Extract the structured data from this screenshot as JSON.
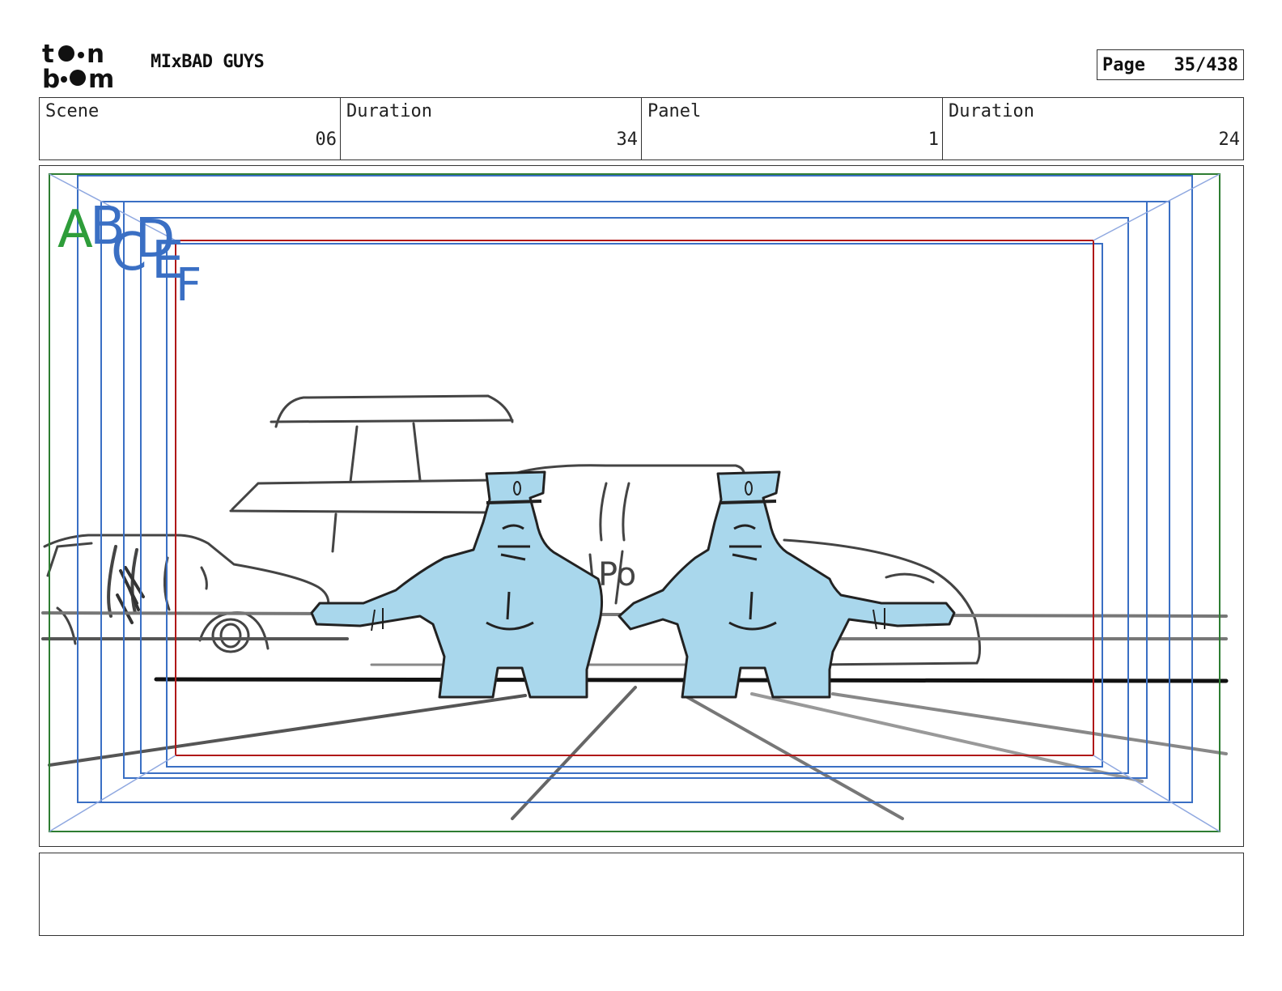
{
  "header": {
    "logo_lines": [
      "toon",
      "boom"
    ],
    "project_title": "MIxBAD GUYS",
    "page_label": "Page",
    "page_number": "35/438"
  },
  "info": {
    "scene_label": "Scene",
    "scene_value": "06",
    "scene_duration_label": "Duration",
    "scene_duration_value": "34",
    "panel_label": "Panel",
    "panel_value": "1",
    "panel_duration_label": "Duration",
    "panel_duration_value": "24"
  },
  "frame_guides": {
    "letters": [
      "A",
      "B",
      "C",
      "D",
      "E",
      "F"
    ],
    "colors": {
      "safe_green": "#2e7d32",
      "field_blue": "#3a6fc4",
      "camera_red": "#b01818",
      "character_fill": "#a9d7ec"
    }
  },
  "caption": {
    "text": ""
  }
}
